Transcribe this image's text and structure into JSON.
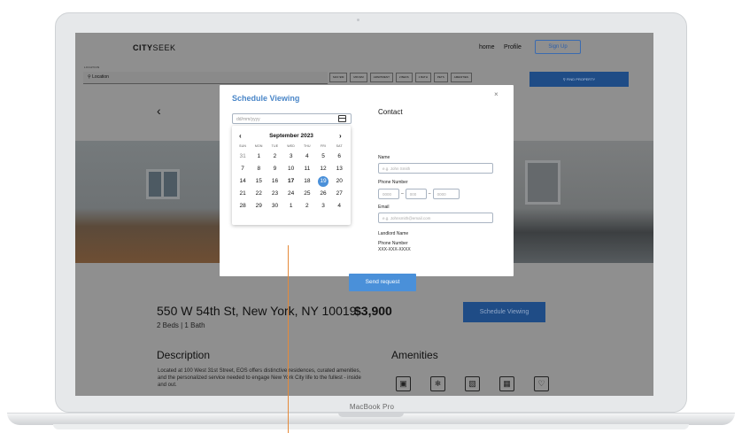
{
  "device": {
    "brand_label": "MacBook Pro"
  },
  "site": {
    "logo_bold": "CITY",
    "logo_light": "SEEK",
    "nav": {
      "home": "home",
      "profile": "Profile",
      "signup": "Sign Up"
    },
    "search": {
      "location_label": "LOCATION",
      "location_placeholder": "Location",
      "filters": [
        "MAX $/M",
        "MIN $/M",
        "APARTMENT",
        "2 BEDS",
        "1 BATH",
        "PETS",
        "AMENITIES"
      ],
      "find_label": "FIND PROPERTY"
    },
    "listing": {
      "address": "550 W 54th St, New York, NY 10019",
      "beds_baths": "2 Beds | 1 Bath",
      "price": "$3,900",
      "schedule_button": "Schedule Viewing",
      "description_heading": "Description",
      "description_text": "Located at 100 West 31st Street, EOS offers distinctive residences, curated amenities, and the personalized service needed to engage New York City life to the fullest - inside and out.",
      "amenities_heading": "Amenities",
      "amenity_icons": [
        "washer-icon",
        "snowflake-icon",
        "gym-icon",
        "dishwasher-icon",
        "pet-icon"
      ]
    }
  },
  "modal": {
    "title": "Schedule Viewing",
    "close": "×",
    "date_placeholder": "dd/mm/yyyy",
    "calendar": {
      "prev": "‹",
      "next": "›",
      "month": "September 2023",
      "weekdays": [
        "SUN",
        "MON",
        "TUE",
        "WED",
        "THU",
        "FRI",
        "SAT"
      ],
      "days": [
        {
          "d": "31",
          "muted": true
        },
        {
          "d": "1"
        },
        {
          "d": "2"
        },
        {
          "d": "3"
        },
        {
          "d": "4"
        },
        {
          "d": "5"
        },
        {
          "d": "6"
        },
        {
          "d": "7"
        },
        {
          "d": "8"
        },
        {
          "d": "9"
        },
        {
          "d": "10"
        },
        {
          "d": "11"
        },
        {
          "d": "12"
        },
        {
          "d": "13"
        },
        {
          "d": "14"
        },
        {
          "d": "15"
        },
        {
          "d": "16"
        },
        {
          "d": "17",
          "bold": true
        },
        {
          "d": "18"
        },
        {
          "d": "19",
          "selected": true
        },
        {
          "d": "20"
        },
        {
          "d": "21"
        },
        {
          "d": "22"
        },
        {
          "d": "23"
        },
        {
          "d": "24"
        },
        {
          "d": "25"
        },
        {
          "d": "26"
        },
        {
          "d": "27"
        },
        {
          "d": "28"
        },
        {
          "d": "29"
        },
        {
          "d": "30"
        },
        {
          "d": "1"
        },
        {
          "d": "2"
        },
        {
          "d": "3"
        },
        {
          "d": "4"
        }
      ]
    },
    "contact": {
      "heading": "Contact",
      "name_label": "Name",
      "name_placeholder": "e.g. John Smith",
      "phone_label": "Phone Number",
      "phone_parts": [
        "0000",
        "000",
        "0000"
      ],
      "email_label": "Email",
      "email_placeholder": "e.g. Johnsmith@email.com",
      "landlord_label": "Landlord Name",
      "landlord_phone_label": "Phone Number",
      "landlord_phone_value": "XXX-XXX-XXXX"
    },
    "send_button": "Send request"
  },
  "colors": {
    "accent": "#4a90d9",
    "overlay_button": "#1f4c86",
    "dim_background": "#8f8f8f",
    "cursor_line": "#e58a3a"
  }
}
